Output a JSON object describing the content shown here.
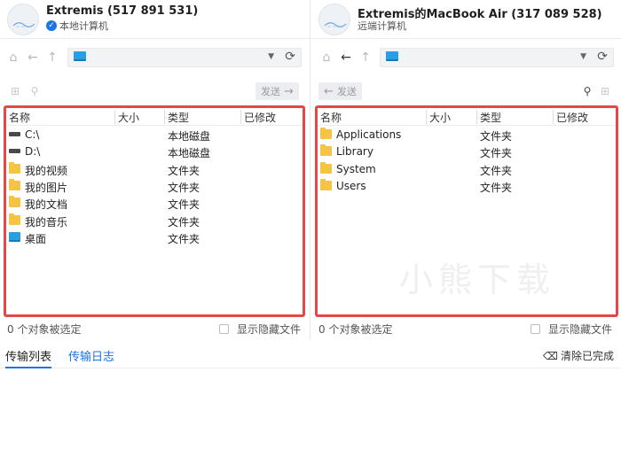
{
  "local": {
    "name": "Extremis (517 891 531)",
    "label": "本地计算机",
    "send_label": "发送",
    "columns": [
      "名称",
      "大小",
      "类型",
      "已修改"
    ],
    "rows": [
      {
        "name": "C:\\",
        "type": "本地磁盘",
        "icon": "disk-icon"
      },
      {
        "name": "D:\\",
        "type": "本地磁盘",
        "icon": "disk-icon"
      },
      {
        "name": "我的视频",
        "type": "文件夹",
        "icon": "folder-icon"
      },
      {
        "name": "我的图片",
        "type": "文件夹",
        "icon": "folder-icon"
      },
      {
        "name": "我的文档",
        "type": "文件夹",
        "icon": "folder-icon"
      },
      {
        "name": "我的音乐",
        "type": "文件夹",
        "icon": "folder-icon"
      },
      {
        "name": "桌面",
        "type": "文件夹",
        "icon": "desktop-icon"
      }
    ],
    "selection_status": "0 个对象被选定",
    "show_hidden_label": "显示隐藏文件"
  },
  "remote": {
    "name": "Extremis的MacBook Air (317 089 528)",
    "label": "远端计算机",
    "send_label": "发送",
    "columns": [
      "名称",
      "大小",
      "类型",
      "已修改"
    ],
    "rows": [
      {
        "name": "Applications",
        "type": "文件夹",
        "icon": "folder-icon"
      },
      {
        "name": "Library",
        "type": "文件夹",
        "icon": "folder-icon"
      },
      {
        "name": "System",
        "type": "文件夹",
        "icon": "folder-icon"
      },
      {
        "name": "Users",
        "type": "文件夹",
        "icon": "folder-icon"
      }
    ],
    "watermark": "小熊下载",
    "selection_status": "0 个对象被选定",
    "show_hidden_label": "显示隐藏文件"
  },
  "bottom": {
    "tabs": [
      "传输列表",
      "传输日志"
    ],
    "clear_completed": "清除已完成"
  },
  "colors": {
    "accent": "#1a73e8",
    "highlight_border": "#e24848",
    "folder": "#f6c343",
    "monitor": "#27a0e1"
  }
}
